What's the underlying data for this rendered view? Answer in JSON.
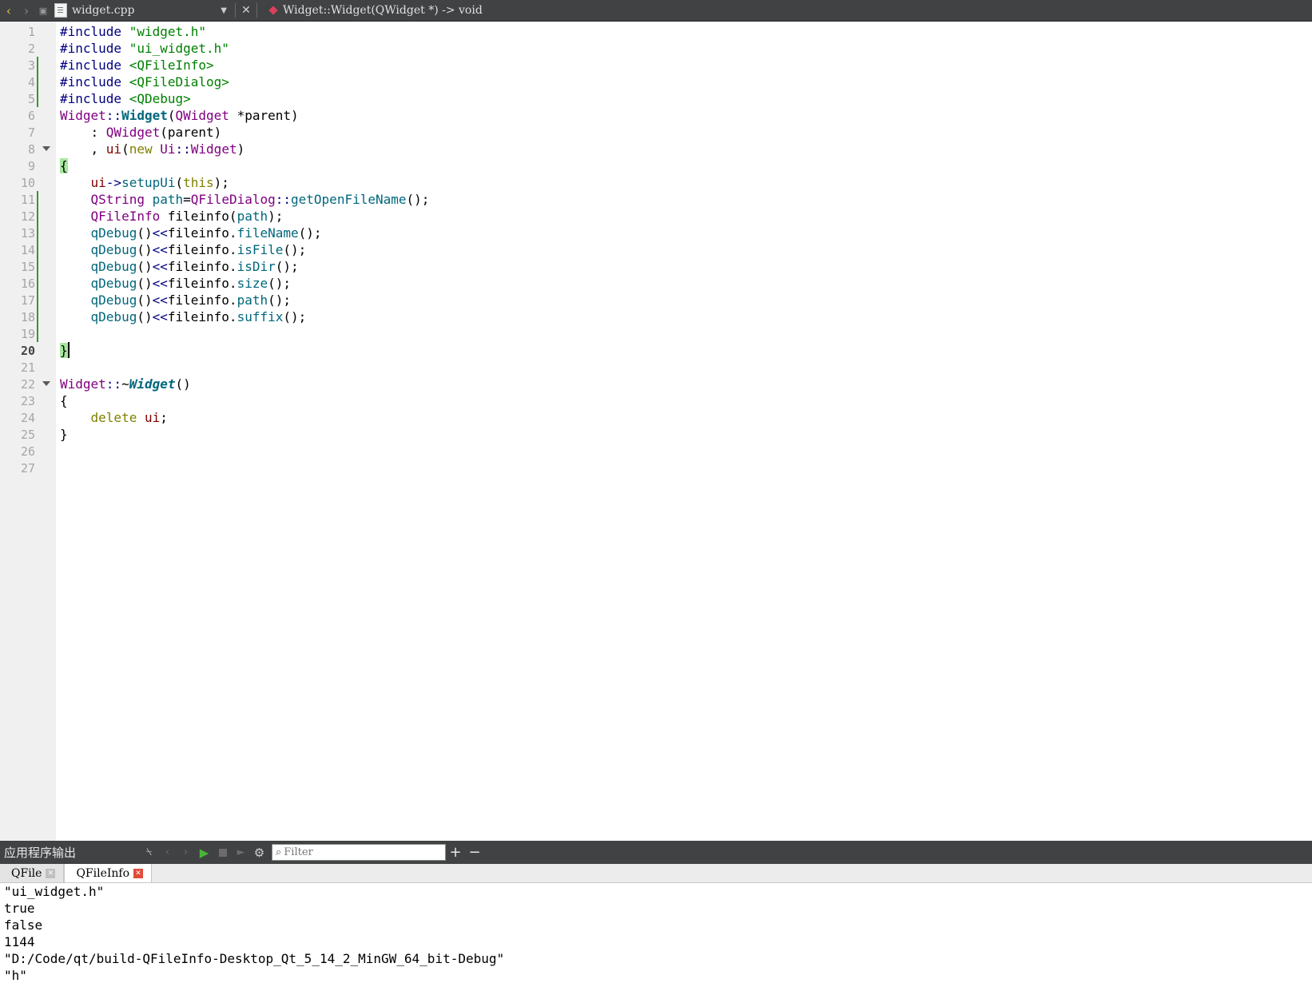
{
  "toolbar": {
    "file_name": "widget.cpp",
    "function_signature": "Widget::Widget(QWidget *) -> void"
  },
  "editor": {
    "line_numbers": [
      "1",
      "2",
      "3",
      "4",
      "5",
      "6",
      "7",
      "8",
      "9",
      "10",
      "11",
      "12",
      "13",
      "14",
      "15",
      "16",
      "17",
      "18",
      "19",
      "20",
      "21",
      "22",
      "23",
      "24",
      "25",
      "26",
      "27"
    ],
    "current_line": "20",
    "code_lines": [
      "#include \"widget.h\"",
      "#include \"ui_widget.h\"",
      "#include <QFileInfo>",
      "#include <QFileDialog>",
      "#include <QDebug>",
      "Widget::Widget(QWidget *parent)",
      "    : QWidget(parent)",
      "    , ui(new Ui::Widget)",
      "{",
      "    ui->setupUi(this);",
      "    QString path=QFileDialog::getOpenFileName();",
      "    QFileInfo fileinfo(path);",
      "    qDebug()<<fileinfo.fileName();",
      "    qDebug()<<fileinfo.isFile();",
      "    qDebug()<<fileinfo.isDir();",
      "    qDebug()<<fileinfo.size();",
      "    qDebug()<<fileinfo.path();",
      "    qDebug()<<fileinfo.suffix();",
      "",
      "}",
      "",
      "Widget::~Widget()",
      "{",
      "    delete ui;",
      "}",
      "",
      ""
    ]
  },
  "output": {
    "title": "应用程序输出",
    "filter_placeholder": "Filter",
    "tabs": [
      {
        "label": "QFile"
      },
      {
        "label": "QFileInfo"
      }
    ],
    "lines": [
      "\"ui_widget.h\"",
      "true",
      "false",
      "1144",
      "\"D:/Code/qt/build-QFileInfo-Desktop_Qt_5_14_2_MinGW_64_bit-Debug\"",
      "\"h\""
    ]
  },
  "colors": {
    "toolbar_bg": "#404244",
    "gutter_bg": "#f0f0f0",
    "modified_bar": "#2e9a2e",
    "preprocessor": "#000080",
    "string": "#008000",
    "class": "#800080",
    "function": "#00677c",
    "keyword": "#808000"
  }
}
